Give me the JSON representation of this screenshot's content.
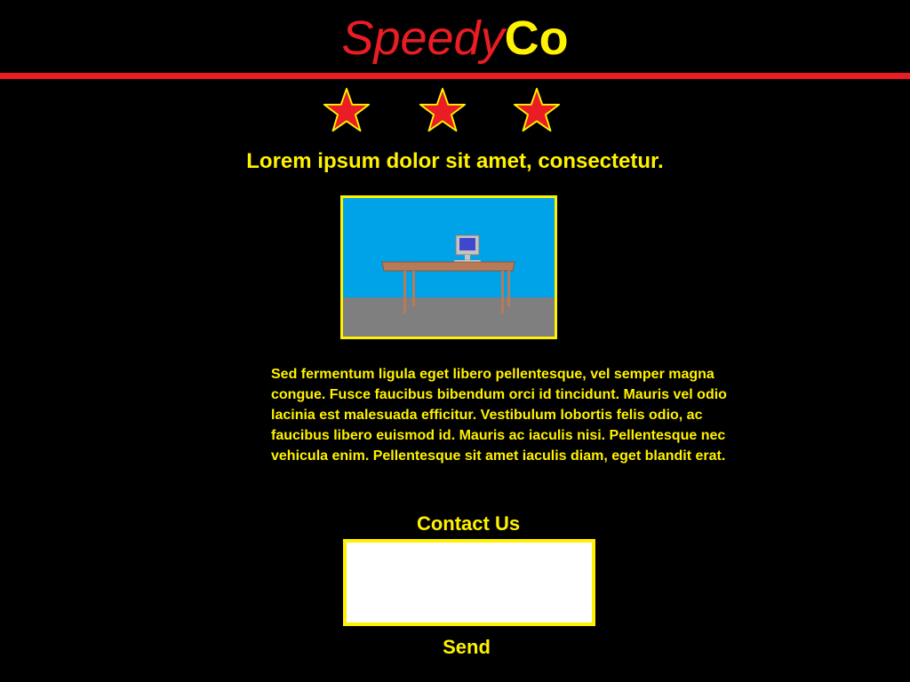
{
  "brand": {
    "part1": "Speedy",
    "part2": "Co"
  },
  "rating": {
    "stars": 3,
    "icon": "star-icon"
  },
  "headline": "Lorem ipsum dolor sit amet, consectetur.",
  "hero": {
    "icon": "desk-computer-image"
  },
  "body_text": "Sed fermentum ligula eget libero pellentesque, vel semper magna congue. Fusce faucibus bibendum orci id tincidunt. Mauris vel odio lacinia est malesuada efficitur. Vestibulum lobortis felis odio, ac faucibus libero euismod id. Mauris ac iaculis nisi. Pellentesque nec vehicula enim. Pellentesque sit amet iaculis diam, eget blandit erat.",
  "contact": {
    "title": "Contact Us",
    "value": "",
    "send_label": "Send"
  },
  "colors": {
    "background": "#000000",
    "red": "#ea1c24",
    "yellow": "#fff200",
    "sky": "#00a2e8",
    "floor": "#7f7f7f",
    "desk": "#b97a57"
  }
}
